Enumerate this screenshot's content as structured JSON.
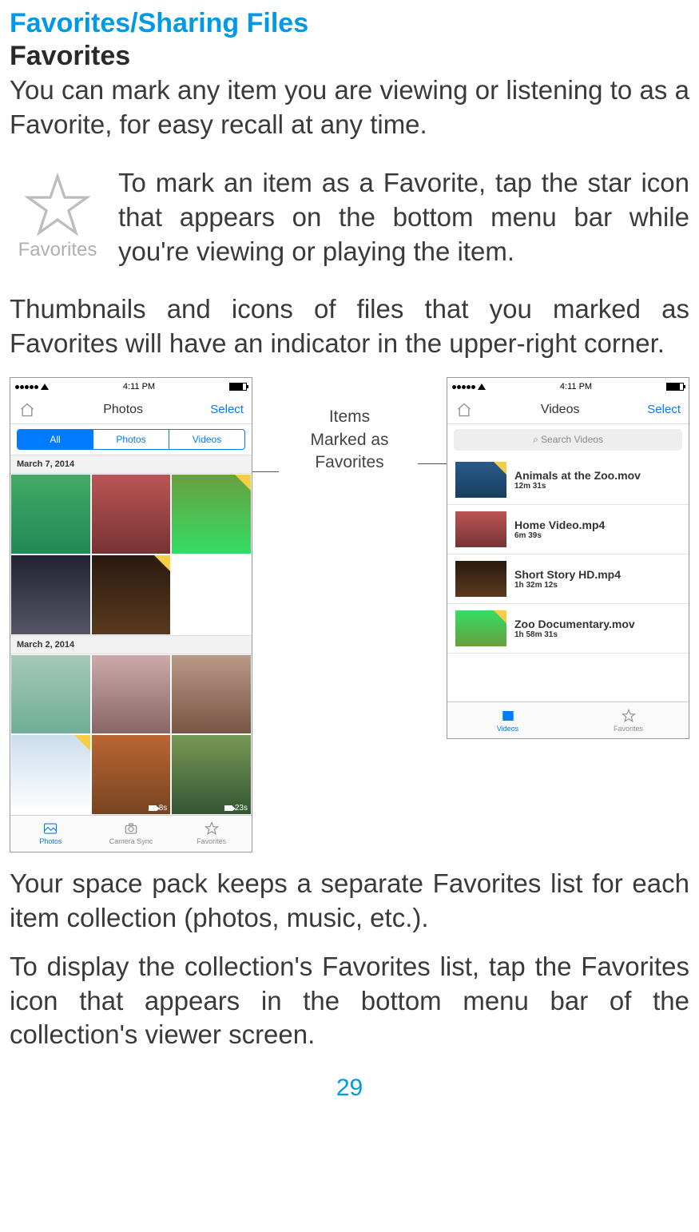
{
  "section_title": "Favorites/Sharing Files",
  "favorites": {
    "heading": "Favorites",
    "intro": "You can mark any item you are viewing or listening to as a Favorite, for easy recall at any time.",
    "icon_label": "Favorites",
    "tip": "To mark an item as a Favorite, tap the star icon that appears on the bottom menu bar while you're viewing or playing the item.",
    "indicator_text": "Thumbnails and icons of files that you marked as Favorites will have an indicator in the upper-right corner."
  },
  "callout_label_line1": "Items",
  "callout_label_line2": "Marked as",
  "callout_label_line3": "Favorites",
  "status": {
    "time": "4:11 PM"
  },
  "photos_screen": {
    "title": "Photos",
    "select": "Select",
    "seg": {
      "all": "All",
      "photos": "Photos",
      "videos": "Videos"
    },
    "date1": "March 7, 2014",
    "date2": "March 2, 2014",
    "dur_8s": "8s",
    "dur_23s": "23s",
    "tabs": {
      "photos": "Photos",
      "camera_sync": "Camera Sync",
      "favorites": "Favorites"
    }
  },
  "videos_screen": {
    "title": "Videos",
    "select": "Select",
    "search_placeholder": "Search Videos",
    "items": [
      {
        "name": "Animals at the Zoo.mov",
        "duration": "12m 31s",
        "fav": true
      },
      {
        "name": "Home Video.mp4",
        "duration": "6m 39s",
        "fav": false
      },
      {
        "name": "Short Story HD.mp4",
        "duration": "1h 32m 12s",
        "fav": false
      },
      {
        "name": "Zoo Documentary.mov",
        "duration": "1h 58m 31s",
        "fav": true
      }
    ],
    "tabs": {
      "videos": "Videos",
      "favorites": "Favorites"
    }
  },
  "para_separate": "Your space pack keeps a separate Favorites list for each item collection (photos, music, etc.).",
  "para_display": "To display the collection's Favorites list, tap the Favorites icon that appears in the bottom menu bar of the collection's viewer screen.",
  "page_number": "29"
}
